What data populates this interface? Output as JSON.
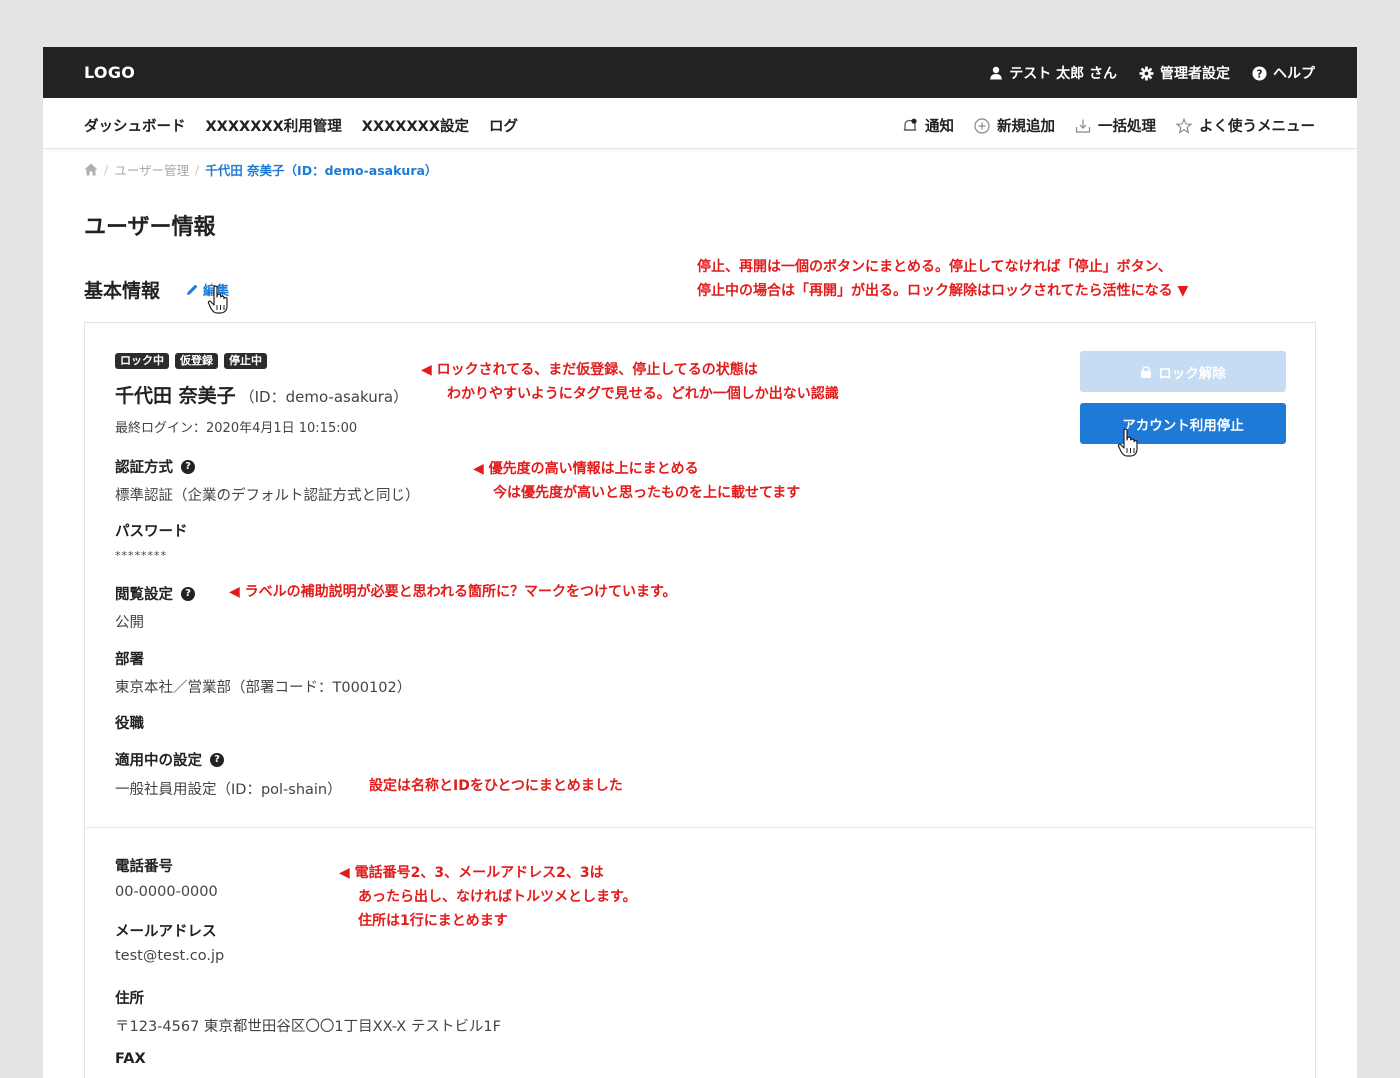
{
  "header": {
    "logo": "LOGO",
    "user_name": "テスト 太郎 さん",
    "admin_settings": "管理者設定",
    "help": "ヘルプ"
  },
  "nav": {
    "items": [
      "ダッシュボード",
      "XXXXXXX利用管理",
      "XXXXXXX設定",
      "ログ"
    ],
    "notification": "通知",
    "new_add": "新規追加",
    "bulk": "一括処理",
    "favorites": "よく使うメニュー"
  },
  "breadcrumb": {
    "user_mgmt": "ユーザー管理",
    "current": "千代田 奈美子（ID：demo-asakura）"
  },
  "page_title": "ユーザー情報",
  "section": {
    "title": "基本情報",
    "edit": "編集"
  },
  "user": {
    "tags": [
      "ロック中",
      "仮登録",
      "停止中"
    ],
    "name": "千代田 奈美子",
    "id": "（ID：demo-asakura）",
    "last_login": "最終ログイン：2020年4月1日 10:15:00"
  },
  "buttons": {
    "unlock": "ロック解除",
    "suspend": "アカウント利用停止"
  },
  "fields": {
    "auth_label": "認証方式",
    "auth_value": "標準認証（企業のデフォルト認証方式と同じ）",
    "password_label": "パスワード",
    "password_value": "********",
    "visibility_label": "閲覧設定",
    "visibility_value": "公開",
    "department_label": "部署",
    "department_value": "東京本社／営業部（部署コード：T000102）",
    "position_label": "役職",
    "policy_label": "適用中の設定",
    "policy_value": "一般社員用設定（ID：pol-shain）",
    "phone_label": "電話番号",
    "phone_value": "00-0000-0000",
    "email_label": "メールアドレス",
    "email_value": "test@test.co.jp",
    "address_label": "住所",
    "address_value": "〒123-4567 東京都世田谷区〇〇1丁目XX-X テストビル1F",
    "fax_label": "FAX"
  },
  "notes": {
    "top_1": "停止、再開は一個のボタンにまとめる。停止してなければ「停止」ボタン、",
    "top_2": "停止中の場合は「再開」が出る。ロック解除はロックされてたら活性になる ▼",
    "tags_1": "◀ ロックされてる、まだ仮登録、停止してるの状態は",
    "tags_2": "わかりやすいようにタグで見せる。どれか一個しか出ない認識",
    "priority_1": "◀ 優先度の高い情報は上にまとめる",
    "priority_2": "今は優先度が高いと思ったものを上に載せてます",
    "help_mark": "◀ ラベルの補助説明が必要と思われる箇所に？マークをつけています。",
    "policy": "設定は名称とIDをひとつにまとめました",
    "contact_1": "◀ 電話番号2、3、メールアドレス2、3は",
    "contact_2": "あったら出し、なければトルツメとします。",
    "contact_3": "住所は1行にまとめます"
  },
  "colors": {
    "accent": "#1e7ad6",
    "note": "#e21b1b",
    "topbar": "#222222",
    "button_disabled": "#c5dcf3"
  }
}
